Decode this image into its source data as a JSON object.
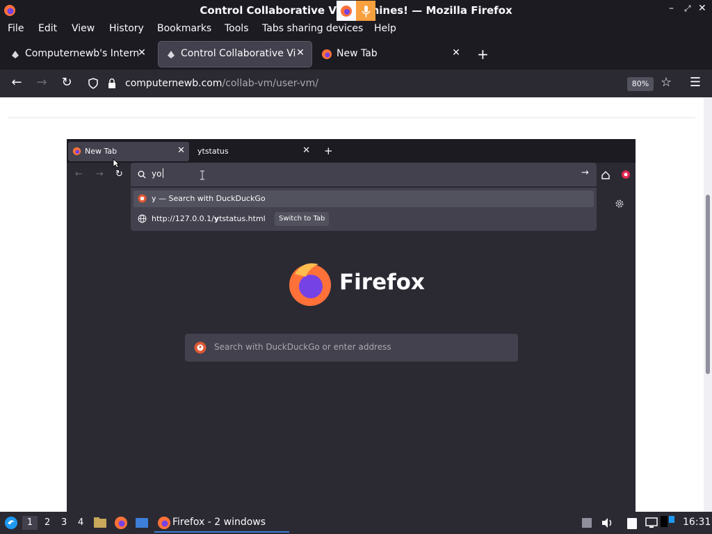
{
  "window": {
    "title": "Control Collaborative Virt... chines! — Mozilla Firefox"
  },
  "menu": [
    "File",
    "Edit",
    "View",
    "History",
    "Bookmarks",
    "Tools",
    "Tabs sharing devices",
    "Help"
  ],
  "tabs": [
    {
      "label": "Computernewb's Interne",
      "active": false
    },
    {
      "label": "Control Collaborative Virt",
      "active": true
    },
    {
      "label": "New Tab",
      "active": false
    }
  ],
  "navbar": {
    "url_host": "computernewb.com",
    "url_path": "/collab-vm/user-vm/",
    "zoom": "80%"
  },
  "vm": {
    "tabs": [
      {
        "label": "New Tab"
      },
      {
        "label": "ytstatus"
      }
    ],
    "urlbar_value": "yo",
    "suggestions": [
      {
        "label": "y — Search with DuckDuckGo"
      },
      {
        "prefix": "http://127.0.0.1/",
        "bold": "y",
        "suffix": "tstatus.html",
        "action": "Switch to Tab"
      }
    ],
    "brand": "Firefox",
    "search_placeholder": "Search with DuckDuckGo or enter address"
  },
  "taskbar": {
    "workspaces": [
      "1",
      "2",
      "3",
      "4"
    ],
    "task_label": "Firefox - 2 windows",
    "clock": "16:31"
  },
  "colors": {
    "chrome_dark": "#1c1b22",
    "toolbar": "#2b2a33",
    "field": "#42414d",
    "text": "#fbfbfe",
    "accent_blue": "#0060df"
  }
}
